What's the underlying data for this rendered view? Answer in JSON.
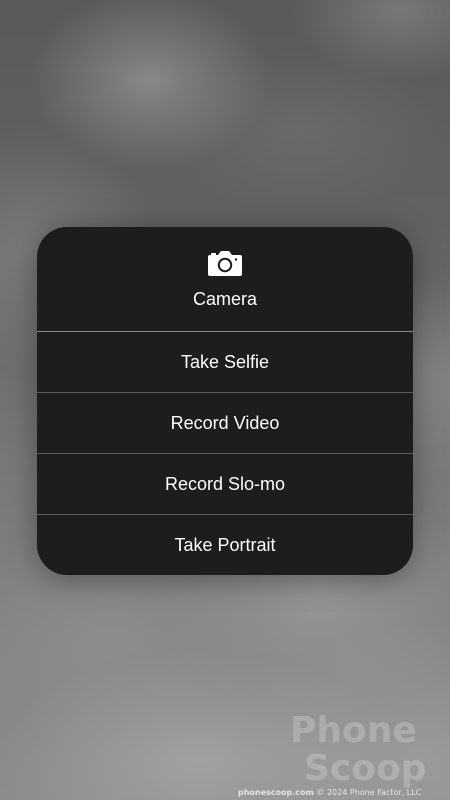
{
  "menu": {
    "header": {
      "icon": "camera-icon",
      "label": "Camera"
    },
    "items": [
      {
        "label": "Take Selfie"
      },
      {
        "label": "Record Video"
      },
      {
        "label": "Record Slo-mo"
      },
      {
        "label": "Take Portrait"
      }
    ]
  },
  "watermark": {
    "logo_line1": "Phone",
    "logo_line2": "Scoop",
    "site": "phonescoop.com",
    "copyright": "© 2024 Phone Factor, LLC"
  },
  "colors": {
    "menu_background": "#1d1d1d",
    "menu_text": "#ffffff",
    "separator": "#5c5c5c"
  }
}
